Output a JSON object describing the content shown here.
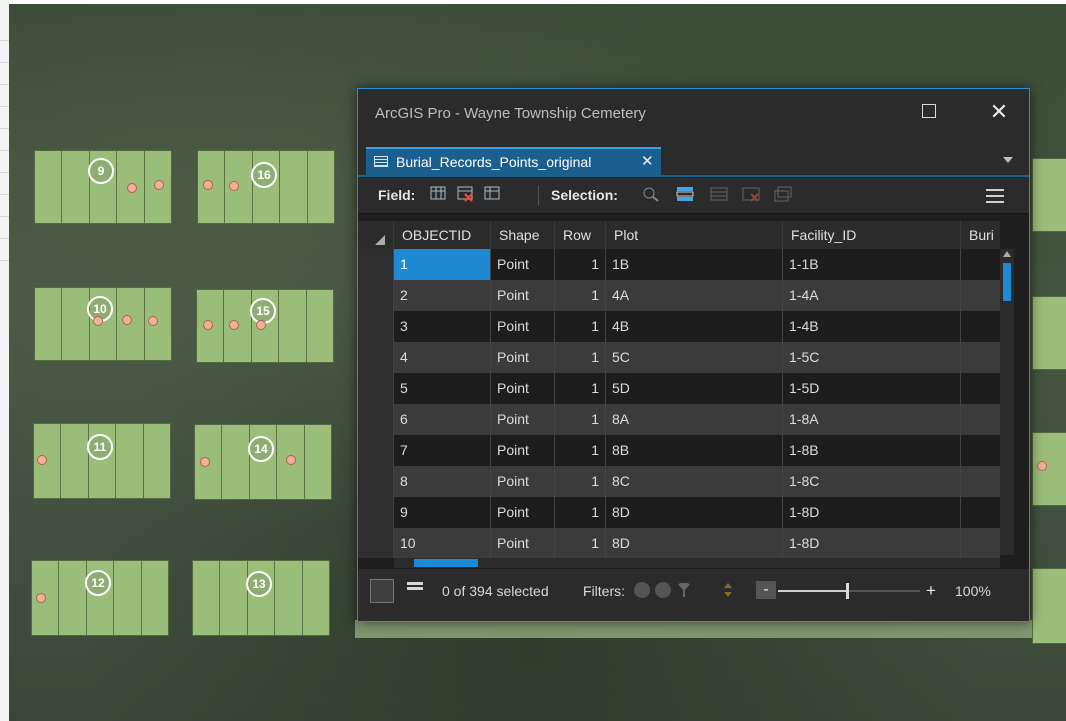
{
  "window": {
    "title": "ArcGIS Pro - Wayne Township Cemetery",
    "close_glyph": "✕"
  },
  "tab": {
    "label": "Burial_Records_Points_original",
    "close_glyph": "✕"
  },
  "toolbar": {
    "field_label": "Field:",
    "selection_label": "Selection:",
    "icons": [
      "add-field-icon",
      "delete-field-icon",
      "calculate-field-icon",
      "zoom-to-selection-icon",
      "switch-selection-icon",
      "clear-selection-icon",
      "delete-selection-icon",
      "copy-selection-icon",
      "menu-icon"
    ]
  },
  "table": {
    "columns": [
      "OBJECTID",
      "Shape",
      "Row",
      "Plot",
      "Facility_ID",
      "Buri"
    ],
    "rows": [
      {
        "objectid": "1",
        "shape": "Point",
        "row": "1",
        "plot": "1B",
        "facility": "1-1B"
      },
      {
        "objectid": "2",
        "shape": "Point",
        "row": "1",
        "plot": "4A",
        "facility": "1-4A"
      },
      {
        "objectid": "3",
        "shape": "Point",
        "row": "1",
        "plot": "4B",
        "facility": "1-4B"
      },
      {
        "objectid": "4",
        "shape": "Point",
        "row": "1",
        "plot": "5C",
        "facility": "1-5C"
      },
      {
        "objectid": "5",
        "shape": "Point",
        "row": "1",
        "plot": "5D",
        "facility": "1-5D"
      },
      {
        "objectid": "6",
        "shape": "Point",
        "row": "1",
        "plot": "8A",
        "facility": "1-8A"
      },
      {
        "objectid": "7",
        "shape": "Point",
        "row": "1",
        "plot": "8B",
        "facility": "1-8B"
      },
      {
        "objectid": "8",
        "shape": "Point",
        "row": "1",
        "plot": "8C",
        "facility": "1-8C"
      },
      {
        "objectid": "9",
        "shape": "Point",
        "row": "1",
        "plot": "8D",
        "facility": "1-8D"
      },
      {
        "objectid": "10",
        "shape": "Point",
        "row": "1",
        "plot": "8D",
        "facility": "1-8D"
      }
    ]
  },
  "status": {
    "selected_text": "0 of 394 selected",
    "filters_label": "Filters:",
    "zoom_minus": "-",
    "zoom_plus": "+",
    "zoom_level": "100%"
  },
  "map": {
    "section_labels": [
      "9",
      "16",
      "10",
      "15",
      "11",
      "14",
      "12",
      "13"
    ]
  },
  "colors": {
    "accent": "#1f8ad4",
    "plot_fill": "#9bbd7a",
    "marker": "#f1b09a"
  }
}
